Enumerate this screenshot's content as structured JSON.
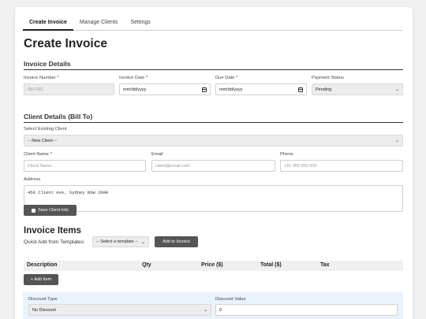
{
  "tabs": [
    "Create Invoice",
    "Manage Clients",
    "Settings"
  ],
  "page_title": "Create Invoice",
  "invoice_details": {
    "heading": "Invoice Details",
    "number_label": "Invoice Number *",
    "number_value": "INV-001",
    "invoice_date_label": "Invoice Date *",
    "invoice_date_value": "mm/dd/yyyy",
    "due_date_label": "Due Date *",
    "due_date_value": "mm/dd/yyyy",
    "status_label": "Payment Status",
    "status_value": "Pending"
  },
  "client_details": {
    "heading": "Client Details (Bill To)",
    "existing_label": "Select Existing Client",
    "existing_value": "-- New Client --",
    "name_label": "Client Name *",
    "name_placeholder": "Client Name",
    "email_label": "Email",
    "email_placeholder": "client@email.com",
    "phone_label": "Phone",
    "phone_placeholder": "+61 400 000 000",
    "address_label": "Address",
    "address_placeholder": "456 Client Ave, Sydney NSW 2000",
    "save_button": "Save Client Info"
  },
  "invoice_items": {
    "heading": "Invoice Items",
    "quick_add_label": "Quick Add from Templates:",
    "template_select": "-- Select a template --",
    "add_to_invoice_button": "Add to Invoice",
    "columns": [
      "Description",
      "Qty",
      "Price ($)",
      "Total ($)",
      "Tax"
    ],
    "add_item_button": "+ Add Item"
  },
  "discount": {
    "type_label": "Discount Type",
    "type_value": "No Discount",
    "value_label": "Discount Value",
    "value_value": "0"
  }
}
